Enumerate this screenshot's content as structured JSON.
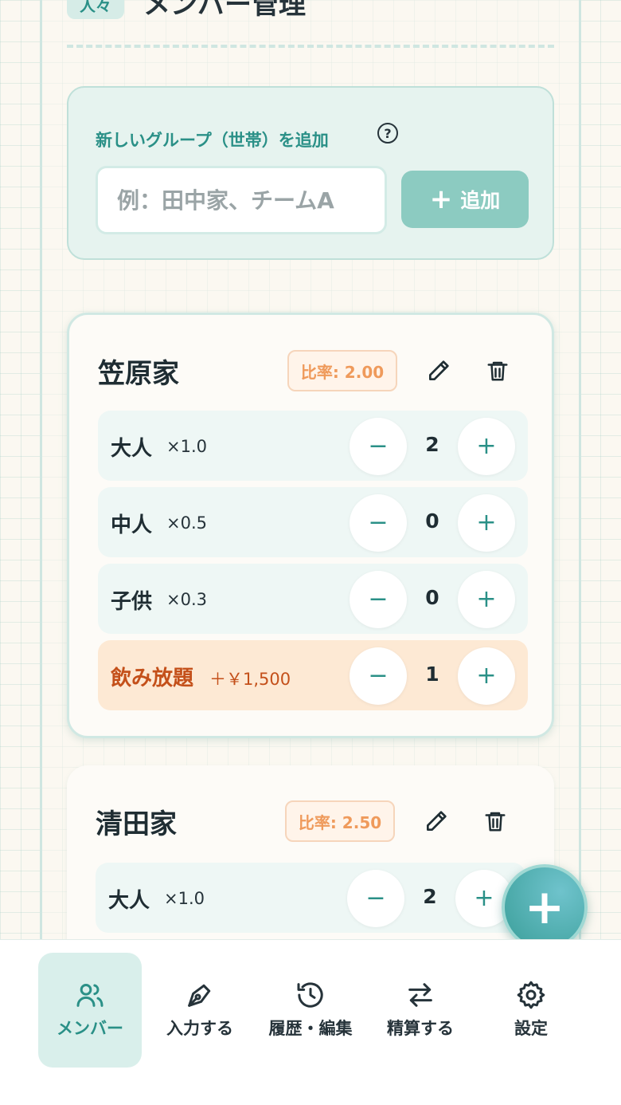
{
  "header": {
    "badge": "人々",
    "title": "メンバー管理"
  },
  "add_group": {
    "label": "新しいグループ（世帯）を追加",
    "help_icon": "help-circle-icon",
    "input_placeholder": "例：田中家、チームA",
    "input_value": "",
    "button_label": "追加"
  },
  "groups": [
    {
      "name": "笠原家",
      "ratio_label": "比率: 2.00",
      "rows": [
        {
          "label": "大人",
          "multiplier": "×1.0",
          "count": "2"
        },
        {
          "label": "中人",
          "multiplier": "×0.5",
          "count": "0"
        },
        {
          "label": "子供",
          "multiplier": "×0.3",
          "count": "0"
        },
        {
          "label": "飲み放題",
          "multiplier": "＋￥1,500",
          "count": "1"
        }
      ]
    },
    {
      "name": "清田家",
      "ratio_label": "比率: 2.50",
      "rows": [
        {
          "label": "大人",
          "multiplier": "×1.0",
          "count": "2"
        }
      ]
    }
  ],
  "nav": [
    {
      "label": "メンバー",
      "icon": "users-icon",
      "active": true
    },
    {
      "label": "入力する",
      "icon": "pen-nib-icon",
      "active": false
    },
    {
      "label": "履歴・編集",
      "icon": "history-icon",
      "active": false
    },
    {
      "label": "精算する",
      "icon": "arrows-swap-icon",
      "active": false
    },
    {
      "label": "設定",
      "icon": "gear-icon",
      "active": false
    }
  ],
  "colors": {
    "accent": "#2a9087",
    "accent_light": "#8ccbc1",
    "ratio_text": "#ef9a5b",
    "drink_text": "#c4501a",
    "drink_bg": "#fde9d4"
  }
}
